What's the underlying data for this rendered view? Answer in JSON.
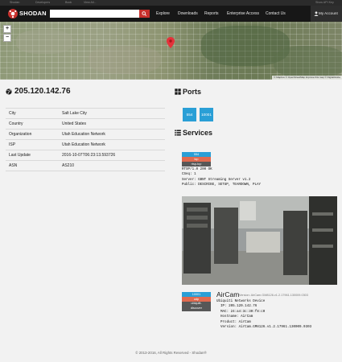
{
  "top_links": [
    "Shodan",
    "Developers",
    "Book",
    "View All..."
  ],
  "top_right_link": "Show API Key",
  "nav": {
    "logo_text": "SHODAN",
    "search_placeholder": "",
    "items": [
      "Explore",
      "Downloads",
      "Reports",
      "Enterprise Access",
      "Contact Us"
    ],
    "account_label": "My Account"
  },
  "map": {
    "zoom_in": "+",
    "zoom_out": "−",
    "attribution": "© Mapbox © OpenStreetMap Improve this map © DigitalGlobe"
  },
  "host": {
    "ip": "205.120.142.76",
    "details": [
      {
        "key": "City",
        "value": "Salt Lake City"
      },
      {
        "key": "Country",
        "value": "United States"
      },
      {
        "key": "Organization",
        "value": "Utah Education Network"
      },
      {
        "key": "ISP",
        "value": "Utah Education Network"
      },
      {
        "key": "Last Update",
        "value": "2016-10-07T06:23:13.593726"
      },
      {
        "key": "ASN",
        "value": "AS210"
      }
    ]
  },
  "ports": {
    "title": "Ports",
    "list": [
      "554",
      "10001"
    ]
  },
  "services": {
    "title": "Services",
    "entries": [
      {
        "port": "554",
        "protocol": "tcp",
        "module": "rtsp-tcp",
        "banner": "RTSP/1.0 200 OK\nCSeq: 1\nServer: GBNT Streaming Server v1.2\nPublic: DESCRIBE, SETUP, TEARDOWN, PLAY"
      },
      {
        "port": "10001",
        "protocol": "udp",
        "module": "ubiquiti-discover",
        "product": "AirCam",
        "version": "Version: AirCam.GM8126.v1.2.17961.130009.0303",
        "banner": "Ubiquiti Networks Device\n  IP: 205.120.142.76\n  MAC: 24:a4:3c:30:f8:c0\n  Hostname: AirCam\n  Product: AirCam\n  Version: AirCam.GM8126.v1.2.17961.130009.0303"
      }
    ]
  },
  "footer": "© 2013-2016, All Rights Reserved - Shodan®",
  "colors": {
    "nav_bg": "#171717",
    "search_button": "#c9302c",
    "port_badge": "#2a9fd6",
    "protocol_badge": "#e06a4f",
    "module_badge": "#575757"
  },
  "icons": {
    "logo": "shodan-logo",
    "search": "search-icon",
    "account": "user-icon",
    "host": "globe-icon",
    "ports": "grid-icon",
    "services": "list-icon",
    "map_marker": "map-pin-icon"
  }
}
